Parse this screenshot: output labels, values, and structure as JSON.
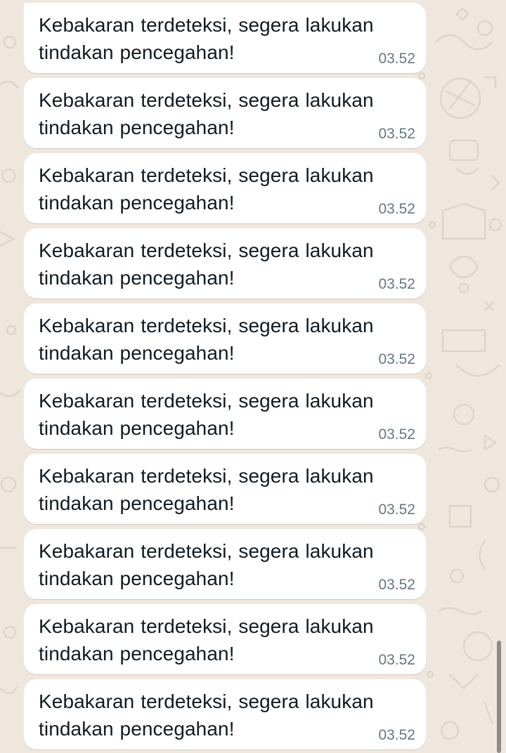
{
  "colors": {
    "background": "#efe7dd",
    "bubble": "#ffffff",
    "text": "#111b21",
    "timestamp": "#667781"
  },
  "messages": [
    {
      "text": "Kebakaran terdeteksi, segera lakukan tindakan pencegahan!",
      "time": "03.52"
    },
    {
      "text": "Kebakaran terdeteksi, segera lakukan tindakan pencegahan!",
      "time": "03.52"
    },
    {
      "text": "Kebakaran terdeteksi, segera lakukan tindakan pencegahan!",
      "time": "03.52"
    },
    {
      "text": "Kebakaran terdeteksi, segera lakukan tindakan pencegahan!",
      "time": "03.52"
    },
    {
      "text": "Kebakaran terdeteksi, segera lakukan tindakan pencegahan!",
      "time": "03.52"
    },
    {
      "text": "Kebakaran terdeteksi, segera lakukan tindakan pencegahan!",
      "time": "03.52"
    },
    {
      "text": "Kebakaran terdeteksi, segera lakukan tindakan pencegahan!",
      "time": "03.52"
    },
    {
      "text": "Kebakaran terdeteksi, segera lakukan tindakan pencegahan!",
      "time": "03.52"
    },
    {
      "text": "Kebakaran terdeteksi, segera lakukan tindakan pencegahan!",
      "time": "03.52"
    },
    {
      "text": "Kebakaran terdeteksi, segera lakukan tindakan pencegahan!",
      "time": "03.52"
    }
  ]
}
